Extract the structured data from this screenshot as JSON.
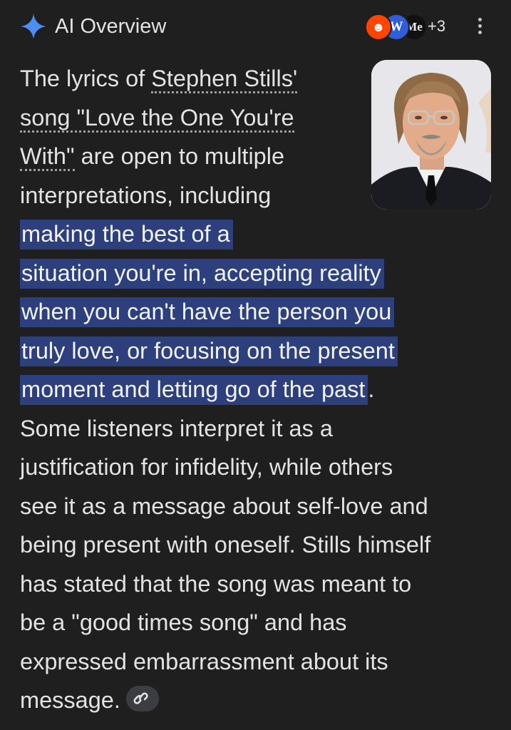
{
  "header": {
    "title": "AI Overview",
    "sources": {
      "reddit_glyph": "☻",
      "wiki_glyph": "W",
      "medium_glyph": "Me",
      "more_label": "+3"
    },
    "menu_icon": "more-vert-icon"
  },
  "overview": {
    "image_alt": "Stephen Stills",
    "lines": {
      "l1_pre": "The lyrics of ",
      "l1_link": "Stephen Stills'",
      "l2_link": "song \"Love the One You're",
      "l3_link": "With\"",
      "l3_post": " are open to multiple",
      "l4": "interpretations, including",
      "l5_hl": "making the best of a",
      "l6_hl": "situation you're in, accepting reality",
      "l7_hl": "when you can't have the person you",
      "l8_hl": "truly love, or focusing on the present",
      "l9_hl": "moment and letting go of the past",
      "l9_post": ".",
      "l10": "Some listeners interpret it as a",
      "l11": "justification for infidelity, while others",
      "l12": "see it as a message about self-love and",
      "l13": "being present with oneself. Stills himself",
      "l14": "has stated that the song was meant to",
      "l15": "be a \"good times song\" and has",
      "l16": "expressed embarrassment about its",
      "l17": "message."
    },
    "link_icon": "link-icon"
  },
  "colors": {
    "background": "#1f1f1f",
    "text": "#e3e3e3",
    "highlight": "#2d3f7c",
    "sparkle_blue": "#4c8df6"
  }
}
